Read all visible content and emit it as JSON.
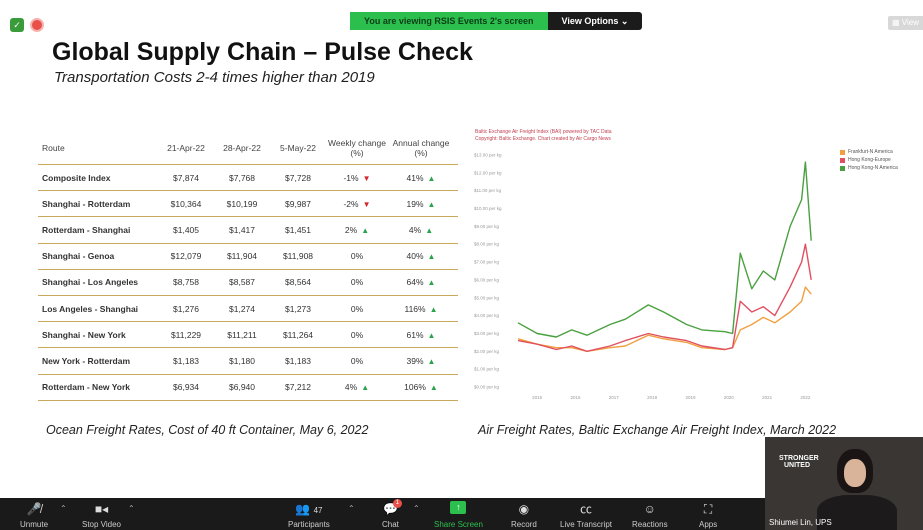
{
  "zoom": {
    "share_banner": "You are viewing RSIS Events 2's screen",
    "view_options": "View Options ⌄",
    "view_button": "View"
  },
  "slide": {
    "title": "Global Supply Chain – Pulse Check",
    "subtitle": "Transportation Costs 2-4 times higher than 2019",
    "caption_left": "Ocean Freight Rates, Cost of 40 ft Container, May 6, 2022",
    "caption_right": "Air Freight Rates, Baltic Exchange Air Freight Index, March 2022"
  },
  "table": {
    "headers": [
      "Route",
      "21-Apr-22",
      "28-Apr-22",
      "5-May-22",
      "Weekly change (%)",
      "Annual change (%)"
    ],
    "rows": [
      {
        "route": "Composite Index",
        "d1": "$7,874",
        "d2": "$7,768",
        "d3": "$7,728",
        "weekly": "-1%",
        "weekly_dir": "down",
        "annual": "41%",
        "annual_dir": "up"
      },
      {
        "route": "Shanghai - Rotterdam",
        "d1": "$10,364",
        "d2": "$10,199",
        "d3": "$9,987",
        "weekly": "-2%",
        "weekly_dir": "down",
        "annual": "19%",
        "annual_dir": "up"
      },
      {
        "route": "Rotterdam - Shanghai",
        "d1": "$1,405",
        "d2": "$1,417",
        "d3": "$1,451",
        "weekly": "2%",
        "weekly_dir": "up",
        "annual": "4%",
        "annual_dir": "up"
      },
      {
        "route": "Shanghai - Genoa",
        "d1": "$12,079",
        "d2": "$11,904",
        "d3": "$11,908",
        "weekly": "0%",
        "weekly_dir": "",
        "annual": "40%",
        "annual_dir": "up"
      },
      {
        "route": "Shanghai - Los Angeles",
        "d1": "$8,758",
        "d2": "$8,587",
        "d3": "$8,564",
        "weekly": "0%",
        "weekly_dir": "",
        "annual": "64%",
        "annual_dir": "up"
      },
      {
        "route": "Los Angeles - Shanghai",
        "d1": "$1,276",
        "d2": "$1,274",
        "d3": "$1,273",
        "weekly": "0%",
        "weekly_dir": "",
        "annual": "116%",
        "annual_dir": "up"
      },
      {
        "route": "Shanghai - New York",
        "d1": "$11,229",
        "d2": "$11,211",
        "d3": "$11,264",
        "weekly": "0%",
        "weekly_dir": "",
        "annual": "61%",
        "annual_dir": "up"
      },
      {
        "route": "New York - Rotterdam",
        "d1": "$1,183",
        "d2": "$1,180",
        "d3": "$1,183",
        "weekly": "0%",
        "weekly_dir": "",
        "annual": "39%",
        "annual_dir": "up"
      },
      {
        "route": "Rotterdam - New York",
        "d1": "$6,934",
        "d2": "$6,940",
        "d3": "$7,212",
        "weekly": "4%",
        "weekly_dir": "up",
        "annual": "106%",
        "annual_dir": "up"
      }
    ]
  },
  "chart_data": {
    "type": "line",
    "title": "Baltic Exchange Air Freight Index (BAI) powered by TAC Data",
    "subtitle": "Copyright: Baltic Exchange. Chart created by Air Cargo News",
    "x_ticks": [
      "2015",
      "2016",
      "2017",
      "2018",
      "2019",
      "2020",
      "2021",
      "2022"
    ],
    "y_ticks": [
      "$0.00 per kg",
      "$1.00 per kg",
      "$2.00 per kg",
      "$3.00 per kg",
      "$4.00 per kg",
      "$5.00 per kg",
      "$6.00 per kg",
      "$7.00 per kg",
      "$8.00 per kg",
      "$9.00 per kg",
      "$10.00 per kg",
      "$11.00 per kg",
      "$12.00 per kg",
      "$13.00 per kg"
    ],
    "ylim": [
      0,
      13
    ],
    "xlim": [
      2014.5,
      2022.25
    ],
    "series": [
      {
        "name": "Frankfurt-N America",
        "color": "#f0a040",
        "x": [
          2014.5,
          2015.0,
          2015.5,
          2015.9,
          2016.3,
          2016.9,
          2017.3,
          2017.9,
          2018.3,
          2018.9,
          2019.3,
          2019.9,
          2020.1,
          2020.3,
          2020.6,
          2020.9,
          2021.2,
          2021.6,
          2021.9,
          2022.0,
          2022.15
        ],
        "y": [
          2.7,
          2.4,
          2.2,
          2.2,
          2.0,
          2.2,
          2.3,
          2.9,
          2.7,
          2.5,
          2.2,
          2.1,
          2.2,
          3.2,
          3.5,
          3.9,
          3.6,
          4.2,
          4.8,
          5.6,
          5.2
        ]
      },
      {
        "name": "Hong Kong-Europe",
        "color": "#e05060",
        "x": [
          2014.5,
          2015.0,
          2015.5,
          2015.9,
          2016.3,
          2016.9,
          2017.3,
          2017.9,
          2018.3,
          2018.9,
          2019.3,
          2019.9,
          2020.1,
          2020.3,
          2020.6,
          2020.9,
          2021.2,
          2021.6,
          2021.9,
          2022.0,
          2022.15
        ],
        "y": [
          2.6,
          2.4,
          2.1,
          2.3,
          2.0,
          2.3,
          2.6,
          3.0,
          2.8,
          2.6,
          2.3,
          2.1,
          2.2,
          4.8,
          4.2,
          4.5,
          4.0,
          5.6,
          7.0,
          8.0,
          6.0
        ]
      },
      {
        "name": "Hong Kong-N America",
        "color": "#4aa040",
        "x": [
          2014.5,
          2015.0,
          2015.5,
          2015.9,
          2016.3,
          2016.9,
          2017.3,
          2017.9,
          2018.3,
          2018.9,
          2019.3,
          2019.9,
          2020.1,
          2020.3,
          2020.6,
          2020.9,
          2021.2,
          2021.6,
          2021.9,
          2022.0,
          2022.15
        ],
        "y": [
          3.6,
          3.0,
          2.8,
          3.2,
          2.9,
          3.5,
          3.8,
          4.6,
          4.2,
          3.5,
          3.2,
          3.1,
          3.0,
          7.5,
          5.5,
          6.5,
          6.0,
          9.0,
          10.5,
          12.6,
          8.2
        ]
      }
    ]
  },
  "video": {
    "name": "Shiumei Lin, UPS",
    "brand_text": "STRONGER UNITED"
  },
  "toolbar": {
    "unmute": "Unmute",
    "stop_video": "Stop Video",
    "participants": "Participants",
    "participants_count": "47",
    "chat": "Chat",
    "chat_badge": "1",
    "share_screen": "Share Screen",
    "record": "Record",
    "live_transcript": "Live Transcript",
    "reactions": "Reactions",
    "apps": "Apps"
  }
}
